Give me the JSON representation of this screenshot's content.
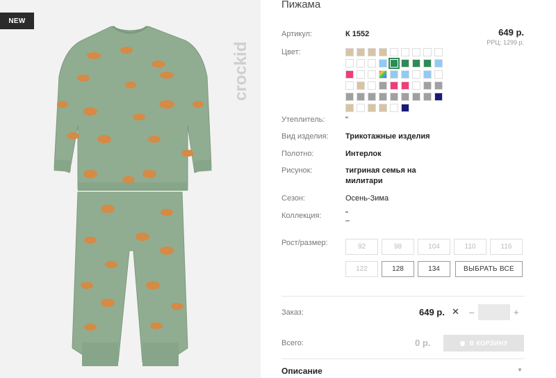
{
  "badge": "NEW",
  "brand": "crockid",
  "product": {
    "title": "Пижама",
    "article_label": "Артикул:",
    "article": "К 1552",
    "price": "649 р.",
    "rrp": "РРЦ: 1299 р.",
    "color_label": "Цвет:",
    "colors": [
      "#d7c4a3",
      "#d7c4a3",
      "#d7c4a3",
      "#d7c4a3",
      "#ffffff",
      "#ffffff",
      "#ffffff",
      "#ffffff",
      "#ffffff",
      "#ffffff",
      "#ffffff",
      "#ffffff",
      "#8ecbf5",
      "#2e8b57",
      "#2e8b57",
      "#2e8b57",
      "#2e8b57",
      "#8ecbf5",
      "#ee3d7a",
      "#ffffff",
      "#ffffff",
      "#rainbow",
      "#8ecbf5",
      "#8ecbf5",
      "#ffffff",
      "#8ecbf5",
      "#ffffff",
      "#ffffff",
      "#d7c4a3",
      "#ffffff",
      "#a0a0a0",
      "#ee3d7a",
      "#ee3d7a",
      "#ffffff",
      "#a0a0a0",
      "#a0a0a0",
      "#a0a0a0",
      "#a0a0a0",
      "#a0a0a0",
      "#a0a0a0",
      "#a0a0a0",
      "#a0a0a0",
      "#a0a0a0",
      "#a0a0a0",
      "#1a1a7a",
      "#d7c4a3",
      "#ffffff",
      "#d7c4a3",
      "#d7c4a3",
      "#ffffff",
      "#1a1a7a"
    ],
    "selected_color_index": 13,
    "insulation_label": "Утеплитель:",
    "insulation": "\"",
    "type_label": "Вид изделия:",
    "type": "Трикотажные изделия",
    "fabric_label": "Полотно:",
    "fabric": "Интерлок",
    "pattern_label": "Рисунок:",
    "pattern_line1": "тигриная семья на",
    "pattern_line2": "милитари",
    "season_label": "Сезон:",
    "season": "Осень-Зима",
    "collection_label": "Коллекция:",
    "collection_line1": "\"",
    "collection_line2": "–",
    "size_label": "Рост/размер:",
    "sizes_row1": [
      "92",
      "98",
      "104",
      "110",
      "116"
    ],
    "sizes_row2": [
      "122",
      "128",
      "134"
    ],
    "select_all": "ВЫБРАТЬ ВСЕ"
  },
  "order": {
    "label": "Заказ:",
    "price": "649 р.",
    "times": "✕",
    "minus": "–",
    "plus": "+",
    "qty": ""
  },
  "total": {
    "label": "Всего:",
    "price": "0 р.",
    "cart_button": "В КОРЗИНУ"
  },
  "description": {
    "label": "Описание",
    "arrow": "▼"
  }
}
